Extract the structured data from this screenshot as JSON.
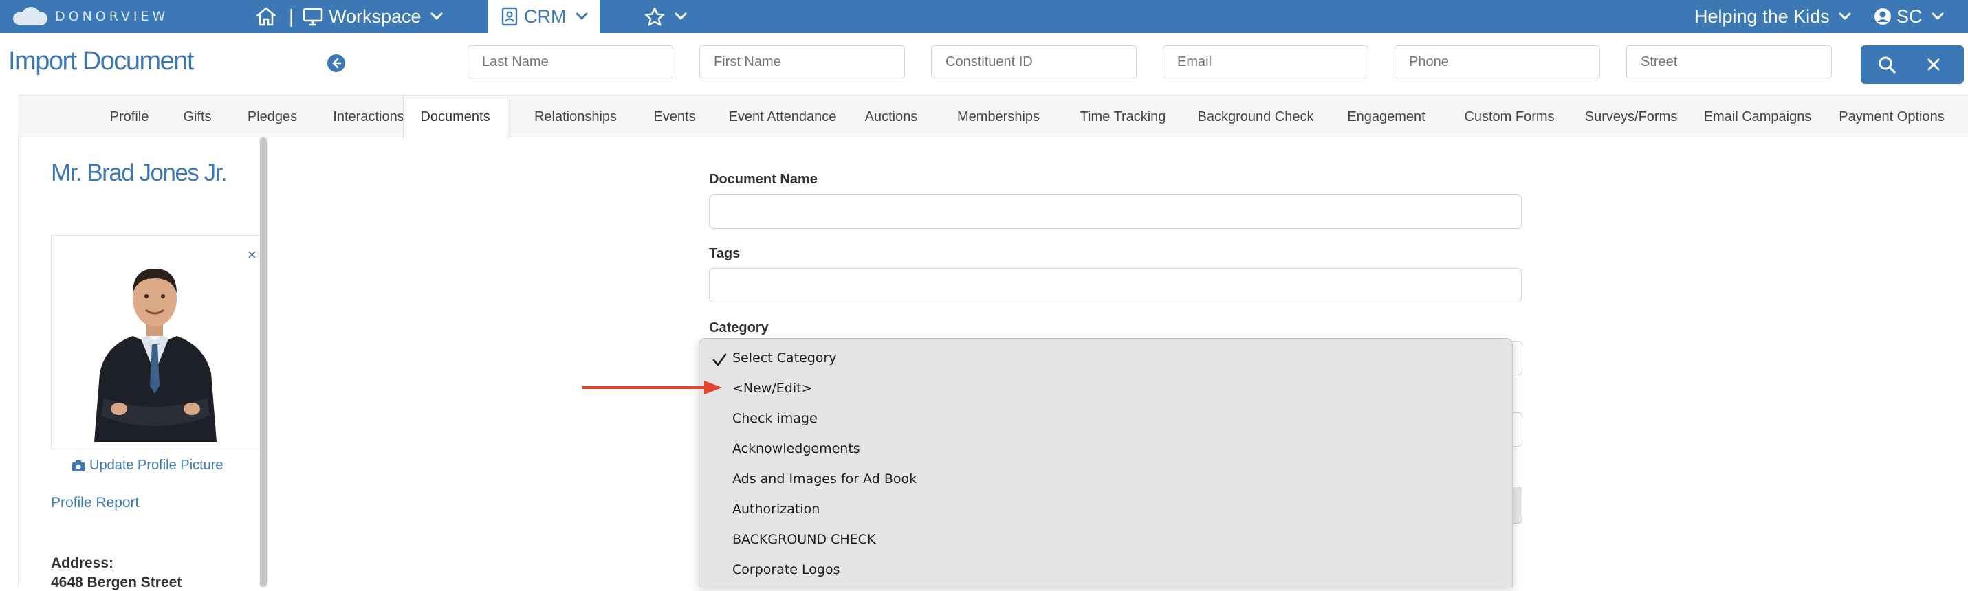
{
  "topbar": {
    "logo_text": "DONORVIEW",
    "workspace_label": "Workspace",
    "crm_label": "CRM",
    "org_label": "Helping the Kids",
    "user_initials": "SC"
  },
  "page": {
    "title": "Import Document"
  },
  "search": {
    "last_name_placeholder": "Last Name",
    "first_name_placeholder": "First Name",
    "constituent_id_placeholder": "Constituent ID",
    "email_placeholder": "Email",
    "phone_placeholder": "Phone",
    "street_placeholder": "Street"
  },
  "tabs": [
    {
      "label": "Profile"
    },
    {
      "label": "Gifts"
    },
    {
      "label": "Pledges"
    },
    {
      "label": "Interactions"
    },
    {
      "label": "Documents"
    },
    {
      "label": "Relationships"
    },
    {
      "label": "Events"
    },
    {
      "label": "Event Attendance"
    },
    {
      "label": "Auctions"
    },
    {
      "label": "Memberships"
    },
    {
      "label": "Time Tracking"
    },
    {
      "label": "Background Check"
    },
    {
      "label": "Engagement"
    },
    {
      "label": "Custom Forms"
    },
    {
      "label": "Surveys/Forms"
    },
    {
      "label": "Email Campaigns"
    },
    {
      "label": "Payment Options"
    }
  ],
  "active_tab": "Documents",
  "profile": {
    "name": "Mr. Brad Jones Jr.",
    "close_symbol": "×",
    "update_picture_label": "Update Profile Picture",
    "profile_report_label": "Profile Report",
    "address_label": "Address:",
    "address_line1": "4648 Bergen Street"
  },
  "form": {
    "document_name_label": "Document Name",
    "document_name_value": "",
    "tags_label": "Tags",
    "tags_value": "",
    "category_label": "Category"
  },
  "category_dropdown": {
    "selected": "Select Category",
    "options": [
      "Select Category",
      "<New/Edit>",
      "Check image",
      "Acknowledgements",
      "Ads and Images for Ad Book",
      "Authorization",
      "BACKGROUND CHECK",
      "Corporate Logos"
    ]
  },
  "colors": {
    "brand_blue": "#3b78b5",
    "annotation_red": "#e8432b",
    "dropdown_bg": "#e4e4e4"
  },
  "icons": {
    "home": "home-icon",
    "workspace": "monitor-icon",
    "crm": "contact-card-icon",
    "favorites": "star-icon",
    "user": "user-circle-icon",
    "back": "arrow-left-circle-icon",
    "search": "search-icon",
    "clear": "close-icon",
    "camera": "camera-icon",
    "check": "checkmark-icon"
  }
}
